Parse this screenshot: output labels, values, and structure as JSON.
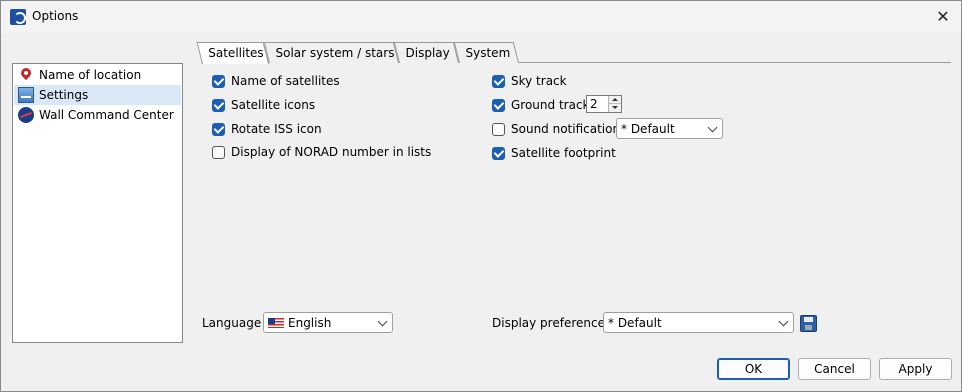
{
  "window": {
    "title": "Options",
    "close_label": "✕"
  },
  "tree": {
    "items": [
      {
        "label": "Name of location",
        "icon": "location-pin-icon"
      },
      {
        "label": "Settings",
        "icon": "settings-icon",
        "selected": true
      },
      {
        "label": "Wall Command Center",
        "icon": "nasa-icon"
      }
    ]
  },
  "tabs": [
    {
      "label": "Satellites",
      "active": true
    },
    {
      "label": "Solar system /  stars"
    },
    {
      "label": "Display"
    },
    {
      "label": "System"
    }
  ],
  "satellites": {
    "name_of_satellites": {
      "label": "Name of satellites",
      "checked": true
    },
    "satellite_icons": {
      "label": "Satellite icons",
      "checked": true
    },
    "rotate_iss_icon": {
      "label": "Rotate ISS icon",
      "checked": true
    },
    "norad_number": {
      "label": "Display of NORAD number in lists",
      "checked": false
    },
    "sky_track": {
      "label": "Sky track",
      "checked": true
    },
    "ground_track": {
      "label": "Ground track",
      "checked": true,
      "value": "2"
    },
    "sound_notification": {
      "label": "Sound notification",
      "checked": false,
      "value": "* Default"
    },
    "satellite_footprint": {
      "label": "Satellite footprint",
      "checked": true
    }
  },
  "language": {
    "label": "Language :",
    "value": "English"
  },
  "display_preferences": {
    "label": "Display preferences :",
    "value": "* Default"
  },
  "buttons": {
    "ok": "OK",
    "cancel": "Cancel",
    "apply": "Apply"
  },
  "colors": {
    "accent": "#1a5fb4",
    "selection": "#d9e8f7"
  }
}
